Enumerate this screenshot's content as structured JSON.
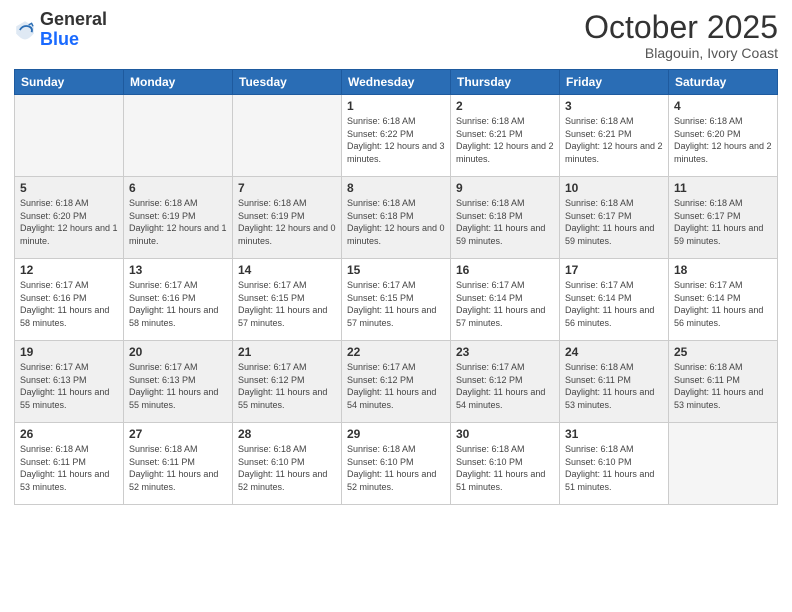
{
  "header": {
    "logo_general": "General",
    "logo_blue": "Blue",
    "month": "October 2025",
    "location": "Blagouin, Ivory Coast"
  },
  "days_of_week": [
    "Sunday",
    "Monday",
    "Tuesday",
    "Wednesday",
    "Thursday",
    "Friday",
    "Saturday"
  ],
  "weeks": [
    {
      "shaded": false,
      "days": [
        {
          "num": "",
          "info": ""
        },
        {
          "num": "",
          "info": ""
        },
        {
          "num": "",
          "info": ""
        },
        {
          "num": "1",
          "info": "Sunrise: 6:18 AM\nSunset: 6:22 PM\nDaylight: 12 hours and 3 minutes."
        },
        {
          "num": "2",
          "info": "Sunrise: 6:18 AM\nSunset: 6:21 PM\nDaylight: 12 hours and 2 minutes."
        },
        {
          "num": "3",
          "info": "Sunrise: 6:18 AM\nSunset: 6:21 PM\nDaylight: 12 hours and 2 minutes."
        },
        {
          "num": "4",
          "info": "Sunrise: 6:18 AM\nSunset: 6:20 PM\nDaylight: 12 hours and 2 minutes."
        }
      ]
    },
    {
      "shaded": true,
      "days": [
        {
          "num": "5",
          "info": "Sunrise: 6:18 AM\nSunset: 6:20 PM\nDaylight: 12 hours and 1 minute."
        },
        {
          "num": "6",
          "info": "Sunrise: 6:18 AM\nSunset: 6:19 PM\nDaylight: 12 hours and 1 minute."
        },
        {
          "num": "7",
          "info": "Sunrise: 6:18 AM\nSunset: 6:19 PM\nDaylight: 12 hours and 0 minutes."
        },
        {
          "num": "8",
          "info": "Sunrise: 6:18 AM\nSunset: 6:18 PM\nDaylight: 12 hours and 0 minutes."
        },
        {
          "num": "9",
          "info": "Sunrise: 6:18 AM\nSunset: 6:18 PM\nDaylight: 11 hours and 59 minutes."
        },
        {
          "num": "10",
          "info": "Sunrise: 6:18 AM\nSunset: 6:17 PM\nDaylight: 11 hours and 59 minutes."
        },
        {
          "num": "11",
          "info": "Sunrise: 6:18 AM\nSunset: 6:17 PM\nDaylight: 11 hours and 59 minutes."
        }
      ]
    },
    {
      "shaded": false,
      "days": [
        {
          "num": "12",
          "info": "Sunrise: 6:17 AM\nSunset: 6:16 PM\nDaylight: 11 hours and 58 minutes."
        },
        {
          "num": "13",
          "info": "Sunrise: 6:17 AM\nSunset: 6:16 PM\nDaylight: 11 hours and 58 minutes."
        },
        {
          "num": "14",
          "info": "Sunrise: 6:17 AM\nSunset: 6:15 PM\nDaylight: 11 hours and 57 minutes."
        },
        {
          "num": "15",
          "info": "Sunrise: 6:17 AM\nSunset: 6:15 PM\nDaylight: 11 hours and 57 minutes."
        },
        {
          "num": "16",
          "info": "Sunrise: 6:17 AM\nSunset: 6:14 PM\nDaylight: 11 hours and 57 minutes."
        },
        {
          "num": "17",
          "info": "Sunrise: 6:17 AM\nSunset: 6:14 PM\nDaylight: 11 hours and 56 minutes."
        },
        {
          "num": "18",
          "info": "Sunrise: 6:17 AM\nSunset: 6:14 PM\nDaylight: 11 hours and 56 minutes."
        }
      ]
    },
    {
      "shaded": true,
      "days": [
        {
          "num": "19",
          "info": "Sunrise: 6:17 AM\nSunset: 6:13 PM\nDaylight: 11 hours and 55 minutes."
        },
        {
          "num": "20",
          "info": "Sunrise: 6:17 AM\nSunset: 6:13 PM\nDaylight: 11 hours and 55 minutes."
        },
        {
          "num": "21",
          "info": "Sunrise: 6:17 AM\nSunset: 6:12 PM\nDaylight: 11 hours and 55 minutes."
        },
        {
          "num": "22",
          "info": "Sunrise: 6:17 AM\nSunset: 6:12 PM\nDaylight: 11 hours and 54 minutes."
        },
        {
          "num": "23",
          "info": "Sunrise: 6:17 AM\nSunset: 6:12 PM\nDaylight: 11 hours and 54 minutes."
        },
        {
          "num": "24",
          "info": "Sunrise: 6:18 AM\nSunset: 6:11 PM\nDaylight: 11 hours and 53 minutes."
        },
        {
          "num": "25",
          "info": "Sunrise: 6:18 AM\nSunset: 6:11 PM\nDaylight: 11 hours and 53 minutes."
        }
      ]
    },
    {
      "shaded": false,
      "days": [
        {
          "num": "26",
          "info": "Sunrise: 6:18 AM\nSunset: 6:11 PM\nDaylight: 11 hours and 53 minutes."
        },
        {
          "num": "27",
          "info": "Sunrise: 6:18 AM\nSunset: 6:11 PM\nDaylight: 11 hours and 52 minutes."
        },
        {
          "num": "28",
          "info": "Sunrise: 6:18 AM\nSunset: 6:10 PM\nDaylight: 11 hours and 52 minutes."
        },
        {
          "num": "29",
          "info": "Sunrise: 6:18 AM\nSunset: 6:10 PM\nDaylight: 11 hours and 52 minutes."
        },
        {
          "num": "30",
          "info": "Sunrise: 6:18 AM\nSunset: 6:10 PM\nDaylight: 11 hours and 51 minutes."
        },
        {
          "num": "31",
          "info": "Sunrise: 6:18 AM\nSunset: 6:10 PM\nDaylight: 11 hours and 51 minutes."
        },
        {
          "num": "",
          "info": ""
        }
      ]
    }
  ]
}
